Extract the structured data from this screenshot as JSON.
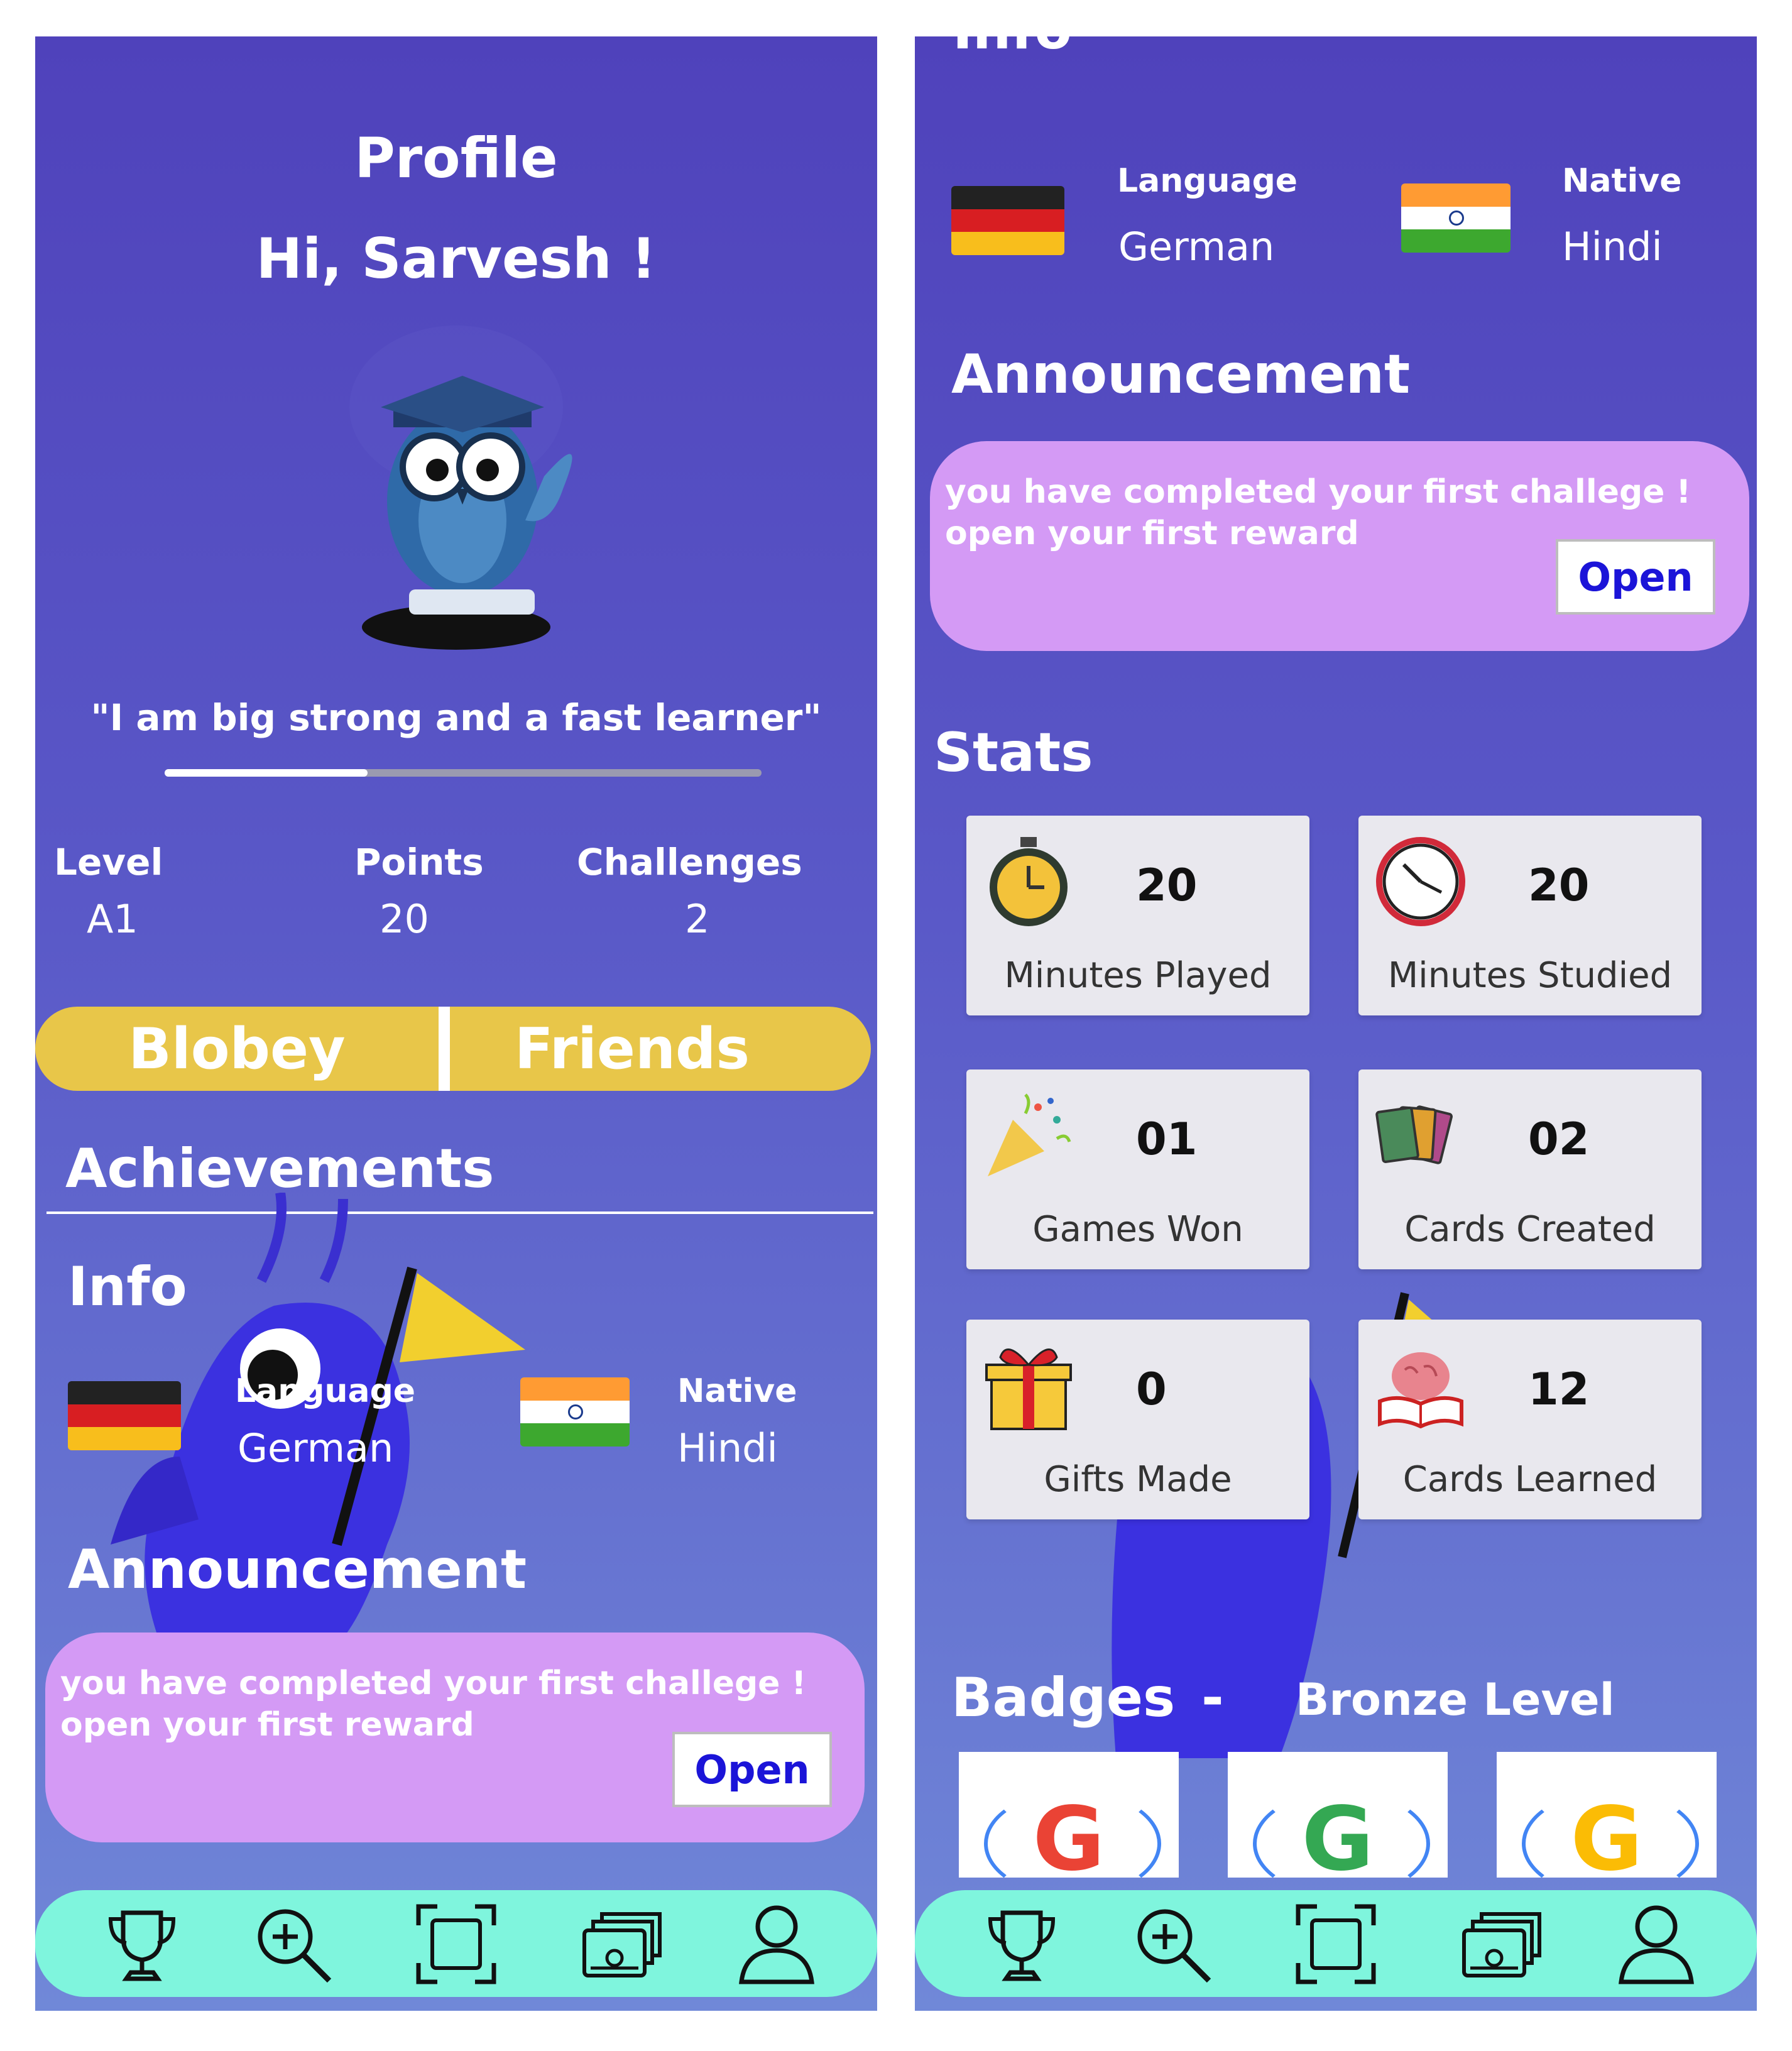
{
  "profile": {
    "title": "Profile",
    "greeting": "Hi, Sarvesh !",
    "quote": "\"I am big strong and a fast learner\"",
    "progress": 0.34,
    "stats": [
      {
        "label": "Level",
        "value": "A1"
      },
      {
        "label": "Points",
        "value": "20"
      },
      {
        "label": "Challenges",
        "value": "2"
      }
    ],
    "toggle": {
      "left": "Blobey",
      "right": "Friends"
    }
  },
  "achievements": {
    "heading": "Achievements"
  },
  "info": {
    "heading": "Info",
    "heading_cropped": "Info",
    "language_label": "Language",
    "language_value": "German",
    "native_label": "Native",
    "native_value": "Hindi"
  },
  "announcement": {
    "heading": "Announcement",
    "line1": "you have completed your first challege !",
    "line2": "open your first reward",
    "button": "Open"
  },
  "stats": {
    "heading": "Stats",
    "cards": [
      {
        "icon": "stopwatch-icon",
        "value": "20",
        "label": "Minutes Played"
      },
      {
        "icon": "clock-icon",
        "value": "20",
        "label": "Minutes Studied"
      },
      {
        "icon": "party-popper-icon",
        "value": "01",
        "label": "Games Won"
      },
      {
        "icon": "cards-icon",
        "value": "02",
        "label": "Cards Created"
      },
      {
        "icon": "gift-icon",
        "value": "0",
        "label": "Gifts Made"
      },
      {
        "icon": "brain-book-icon",
        "value": "12",
        "label": "Cards Learned"
      }
    ]
  },
  "badges": {
    "heading": "Badges",
    "separator": "-",
    "level": "Bronze Level",
    "items": [
      "G",
      "G",
      "G"
    ]
  },
  "nav": [
    "trophy-icon",
    "search-plus-icon",
    "scan-icon",
    "cards-stack-icon",
    "user-icon"
  ],
  "colors": {
    "background_top": "#4f42bb",
    "background_bottom": "#7088d8",
    "toggle": "#e8c649",
    "announcement": "#d49af5",
    "navbar": "#7ff5dd",
    "open_text": "#1b14d8"
  }
}
